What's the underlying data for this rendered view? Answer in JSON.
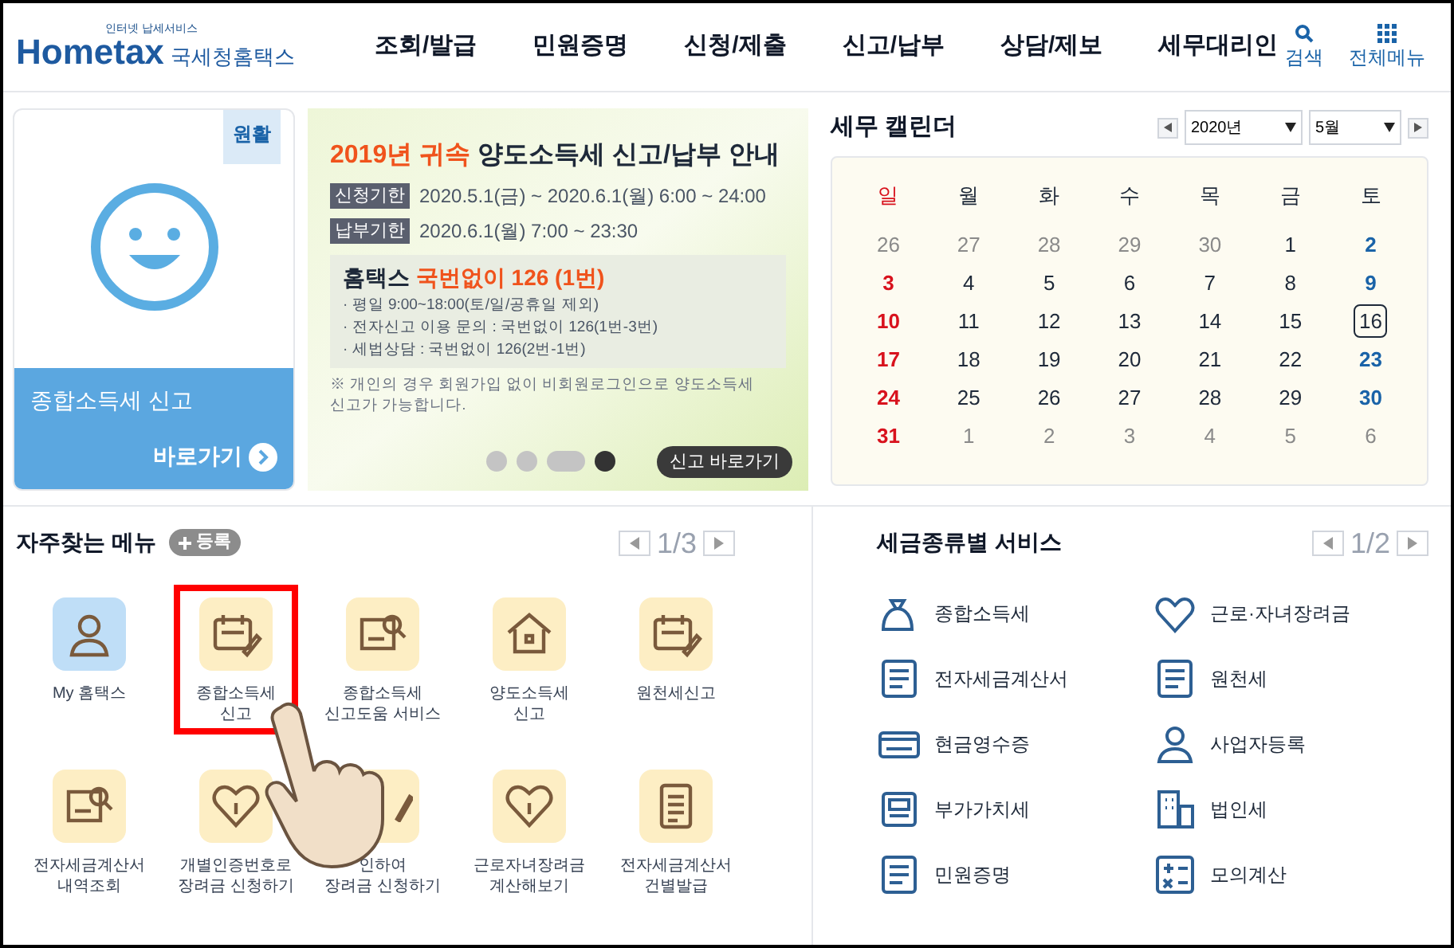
{
  "header": {
    "logo_small": "인터넷 납세서비스",
    "logo_main": "Hometax",
    "logo_sub": "국세청홈택스",
    "nav": [
      "조회/발급",
      "민원증명",
      "신청/제출",
      "신고/납부",
      "상담/제보",
      "세무대리인"
    ],
    "search": "검색",
    "all_menu": "전체메뉴"
  },
  "quick_card": {
    "badge": "원활",
    "title": "종합소득세 신고",
    "link": "바로가기"
  },
  "banner": {
    "year_title": "2019년 귀속",
    "title": "양도소득세 신고/납부 안내",
    "periods": [
      {
        "tag": "신청기한",
        "text": "2020.5.1(금) ~ 2020.6.1(월) 6:00 ~ 24:00"
      },
      {
        "tag": "납부기한",
        "text": "2020.6.1(월) 7:00 ~ 23:30"
      }
    ],
    "box_title": "홈택스",
    "box_highlight": "국번없이 126 (1번)",
    "box_lines": [
      "· 평일 9:00~18:00(토/일/공휴일 제외)",
      "· 전자신고 이용 문의 : 국번없이 126(1번-3번)",
      "· 세법상담 : 국번없이 126(2번-1번)"
    ],
    "note": "※ 개인의 경우 회원가입 없이 비회원로그인으로 양도소득세 신고가 가능합니다.",
    "pager": [
      {
        "kind": "dot",
        "selected": false
      },
      {
        "kind": "dot",
        "selected": false
      },
      {
        "kind": "bar",
        "selected": false
      },
      {
        "kind": "stop",
        "selected": true
      }
    ],
    "button": "신고 바로가기"
  },
  "calendar": {
    "title": "세무 캘린더",
    "year": "2020년",
    "month": "5월",
    "weekdays": [
      {
        "label": "일",
        "kind": "sun"
      },
      {
        "label": "월",
        "kind": "day"
      },
      {
        "label": "화",
        "kind": "day"
      },
      {
        "label": "수",
        "kind": "day"
      },
      {
        "label": "목",
        "kind": "day"
      },
      {
        "label": "금",
        "kind": "day"
      },
      {
        "label": "토",
        "kind": "day"
      }
    ],
    "days": [
      {
        "n": "26",
        "kind": "other",
        "selected": false
      },
      {
        "n": "27",
        "kind": "other",
        "selected": false
      },
      {
        "n": "28",
        "kind": "other",
        "selected": false
      },
      {
        "n": "29",
        "kind": "other",
        "selected": false
      },
      {
        "n": "30",
        "kind": "other",
        "selected": false
      },
      {
        "n": "1",
        "kind": "day",
        "selected": false
      },
      {
        "n": "2",
        "kind": "sat",
        "selected": false
      },
      {
        "n": "3",
        "kind": "sun",
        "selected": false
      },
      {
        "n": "4",
        "kind": "day",
        "selected": false
      },
      {
        "n": "5",
        "kind": "day",
        "selected": false
      },
      {
        "n": "6",
        "kind": "day",
        "selected": false
      },
      {
        "n": "7",
        "kind": "day",
        "selected": false
      },
      {
        "n": "8",
        "kind": "day",
        "selected": false
      },
      {
        "n": "9",
        "kind": "sat",
        "selected": false
      },
      {
        "n": "10",
        "kind": "sun",
        "selected": false
      },
      {
        "n": "11",
        "kind": "day",
        "selected": false
      },
      {
        "n": "12",
        "kind": "day",
        "selected": false
      },
      {
        "n": "13",
        "kind": "day",
        "selected": false
      },
      {
        "n": "14",
        "kind": "day",
        "selected": false
      },
      {
        "n": "15",
        "kind": "day",
        "selected": false
      },
      {
        "n": "16",
        "kind": "day",
        "selected": true
      },
      {
        "n": "17",
        "kind": "sun",
        "selected": false
      },
      {
        "n": "18",
        "kind": "day",
        "selected": false
      },
      {
        "n": "19",
        "kind": "day",
        "selected": false
      },
      {
        "n": "20",
        "kind": "day",
        "selected": false
      },
      {
        "n": "21",
        "kind": "day",
        "selected": false
      },
      {
        "n": "22",
        "kind": "day",
        "selected": false
      },
      {
        "n": "23",
        "kind": "sat",
        "selected": false
      },
      {
        "n": "24",
        "kind": "sun",
        "selected": false
      },
      {
        "n": "25",
        "kind": "day",
        "selected": false
      },
      {
        "n": "26",
        "kind": "day",
        "selected": false
      },
      {
        "n": "27",
        "kind": "day",
        "selected": false
      },
      {
        "n": "28",
        "kind": "day",
        "selected": false
      },
      {
        "n": "29",
        "kind": "day",
        "selected": false
      },
      {
        "n": "30",
        "kind": "sat",
        "selected": false
      },
      {
        "n": "31",
        "kind": "sun",
        "selected": false
      },
      {
        "n": "1",
        "kind": "other",
        "selected": false
      },
      {
        "n": "2",
        "kind": "other",
        "selected": false
      },
      {
        "n": "3",
        "kind": "other",
        "selected": false
      },
      {
        "n": "4",
        "kind": "other",
        "selected": false
      },
      {
        "n": "5",
        "kind": "other",
        "selected": false
      },
      {
        "n": "6",
        "kind": "other",
        "selected": false
      }
    ]
  },
  "favorites": {
    "title": "자주찾는 메뉴",
    "add": "등록",
    "page": "1/3",
    "items": [
      {
        "lines": [
          "My 홈택스"
        ],
        "kind": "blue",
        "selected": false
      },
      {
        "lines": [
          "종합소득세",
          "신고"
        ],
        "kind": "yellow",
        "selected": true
      },
      {
        "lines": [
          "종합소득세",
          "신고도움 서비스"
        ],
        "kind": "yellow",
        "selected": false
      },
      {
        "lines": [
          "양도소득세",
          "신고"
        ],
        "kind": "yellow",
        "selected": false
      },
      {
        "lines": [
          "원천세신고"
        ],
        "kind": "yellow",
        "selected": false
      },
      {
        "lines": [
          "전자세금계산서",
          "내역조회"
        ],
        "kind": "yellow",
        "selected": false
      },
      {
        "lines": [
          "개별인증번호로",
          "장려금 신청하기"
        ],
        "kind": "yellow",
        "selected": false
      },
      {
        "lines": [
          "인하여",
          "장려금 신청하기"
        ],
        "kind": "yellow",
        "selected": false
      },
      {
        "lines": [
          "근로자녀장려금",
          "계산해보기"
        ],
        "kind": "yellow",
        "selected": false
      },
      {
        "lines": [
          "전자세금계산서",
          "건별발급"
        ],
        "kind": "yellow",
        "selected": false
      }
    ]
  },
  "tax_services": {
    "title": "세금종류별 서비스",
    "page": "1/2",
    "items": [
      "종합소득세",
      "근로·자녀장려금",
      "전자세금계산서",
      "원천세",
      "현금영수증",
      "사업자등록",
      "부가가치세",
      "법인세",
      "민원증명",
      "모의계산"
    ]
  }
}
